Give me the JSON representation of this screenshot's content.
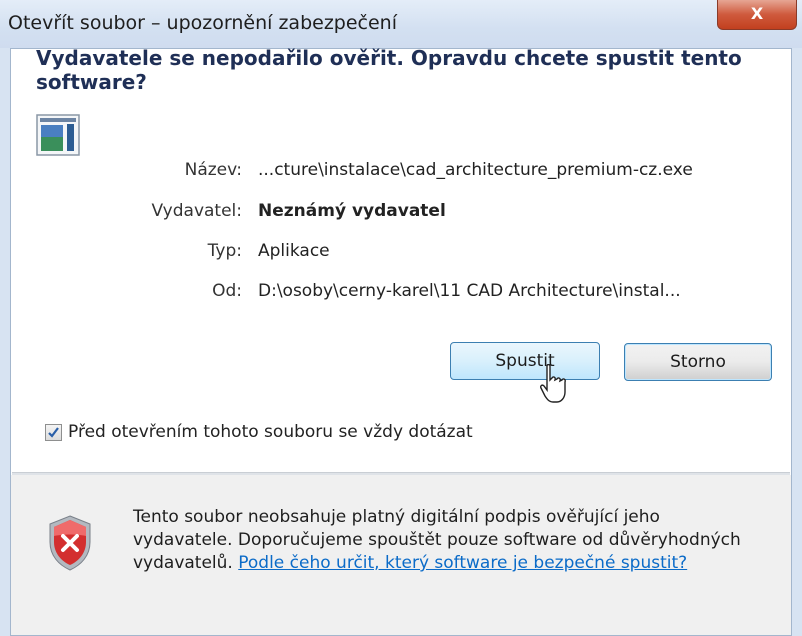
{
  "window": {
    "title": "Otevřít soubor – upozornění zabezpečení",
    "close_glyph": "X"
  },
  "dialog": {
    "heading": "Vydavatele se nepodařilo ověřit. Opravdu chcete spustit tento software?",
    "file_icon": "application-window-icon",
    "fields": [
      {
        "label": "Název:",
        "value": "...cture\\instalace\\cad_architecture_premium-cz.exe"
      },
      {
        "label": "Vydavatel:",
        "value": "Neznámý vydavatel"
      },
      {
        "label": "Typ:",
        "value": "Aplikace"
      },
      {
        "label": "Od:",
        "value": "D:\\osoby\\cerny-karel\\11 CAD Architecture\\instal..."
      }
    ],
    "run_label": "Spustit",
    "cancel_label": "Storno",
    "checkbox_label": "Před otevřením tohoto souboru se vždy dotázat",
    "checkbox_checked": true
  },
  "footer": {
    "icon": "security-shield-error-icon",
    "message": "Tento soubor neobsahuje platný digitální podpis ověřující jeho vydavatele. Doporučujeme spouštět pouze software od důvěryhodných vydavatelů.",
    "link": "Podle čeho určit, který software je bezpečné spustit?"
  },
  "colors": {
    "heading": "#1f2f56",
    "link": "#0b6bc8",
    "close_button": "#c2401f",
    "shield": "#c62828"
  }
}
